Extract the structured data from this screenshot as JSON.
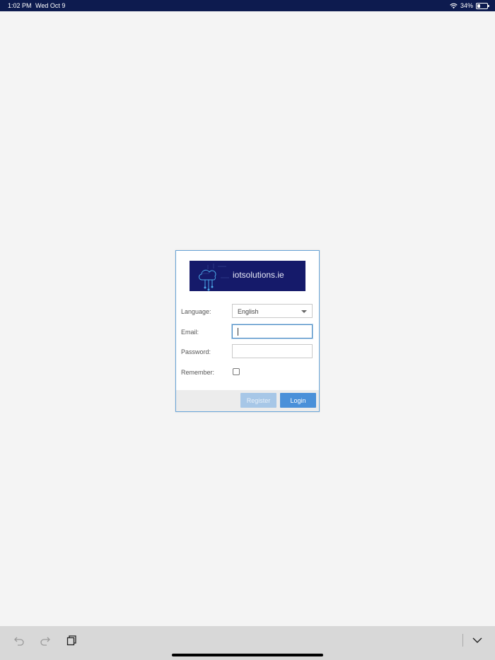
{
  "status_bar": {
    "time": "1:02 PM",
    "date": "Wed Oct 9",
    "battery_percent": "34%",
    "battery_level": 0.34,
    "wifi_icon": "wifi-icon",
    "battery_icon": "battery-icon"
  },
  "login": {
    "logo_text": "iotsolutions.ie",
    "language_label": "Language:",
    "language_value": "English",
    "email_label": "Email:",
    "email_value": "",
    "password_label": "Password:",
    "password_value": "",
    "remember_label": "Remember:",
    "remember_checked": false,
    "register_label": "Register",
    "login_label": "Login"
  },
  "toolbar": {
    "undo_icon": "undo-icon",
    "redo_icon": "redo-icon",
    "paste_icon": "clipboard-icon",
    "collapse_icon": "chevron-down-icon"
  },
  "colors": {
    "status_bar": "#0d1b4f",
    "logo_bg": "#151a6a",
    "login_button": "#4a90d9",
    "register_button": "#a7c7e7",
    "dialog_border": "#6aa5d8"
  }
}
